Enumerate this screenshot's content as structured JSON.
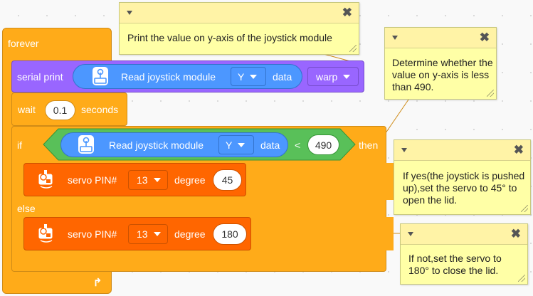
{
  "blocks": {
    "forever_label": "forever",
    "serial_print": {
      "label": "serial print",
      "reporter_label": "Read joystick module",
      "axis": "Y",
      "data_label": "data",
      "mode": "warp"
    },
    "wait": {
      "label": "wait",
      "value": "0.1",
      "unit": "seconds"
    },
    "if": {
      "label": "if",
      "reporter_label": "Read joystick module",
      "axis": "Y",
      "data_label": "data",
      "operator": "<",
      "value": "490",
      "then_label": "then"
    },
    "servo_if": {
      "label": "servo PIN#",
      "pin": "13",
      "degree_label": "degree",
      "value": "45"
    },
    "else_label": "else",
    "servo_else": {
      "label": "servo PIN#",
      "pin": "13",
      "degree_label": "degree",
      "value": "180"
    }
  },
  "notes": {
    "note1": "Print the value on y-axis of the joystick module",
    "note2": "Determine whether the value on y-axis is less than 490.",
    "note3": "If yes(the joystick is pushed up),set the servo to 45° to open the lid.",
    "note4": "If not,set the servo to 180° to close the lid."
  },
  "colors": {
    "control": "#ffab19",
    "serial": "#9966ff",
    "sensor": "#4c97ff",
    "operator": "#59c059",
    "servo": "#ff6600",
    "note": "#ffffa6"
  },
  "icons": {
    "joystick": "joystick-icon",
    "servo": "servo-icon",
    "loop": "loop-arrow-icon",
    "collapse": "collapse-triangle-icon",
    "close": "close-icon",
    "resize": "resize-grip-icon"
  }
}
